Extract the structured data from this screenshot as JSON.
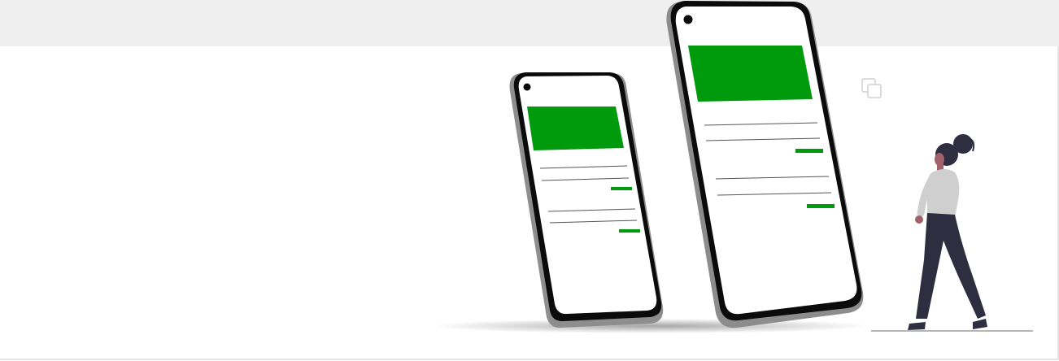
{
  "colors": {
    "background_bar": "#efefef",
    "panel": "#ffffff",
    "accent_green": "#009a0d",
    "phone_frame": "#0a0a0a",
    "phone_bezel": "#8c8c8c",
    "person_top": "#cfcfcf",
    "person_pants": "#2f2e41",
    "person_skin": "#a0616a"
  },
  "icons": {
    "copy": "copy-icon"
  }
}
